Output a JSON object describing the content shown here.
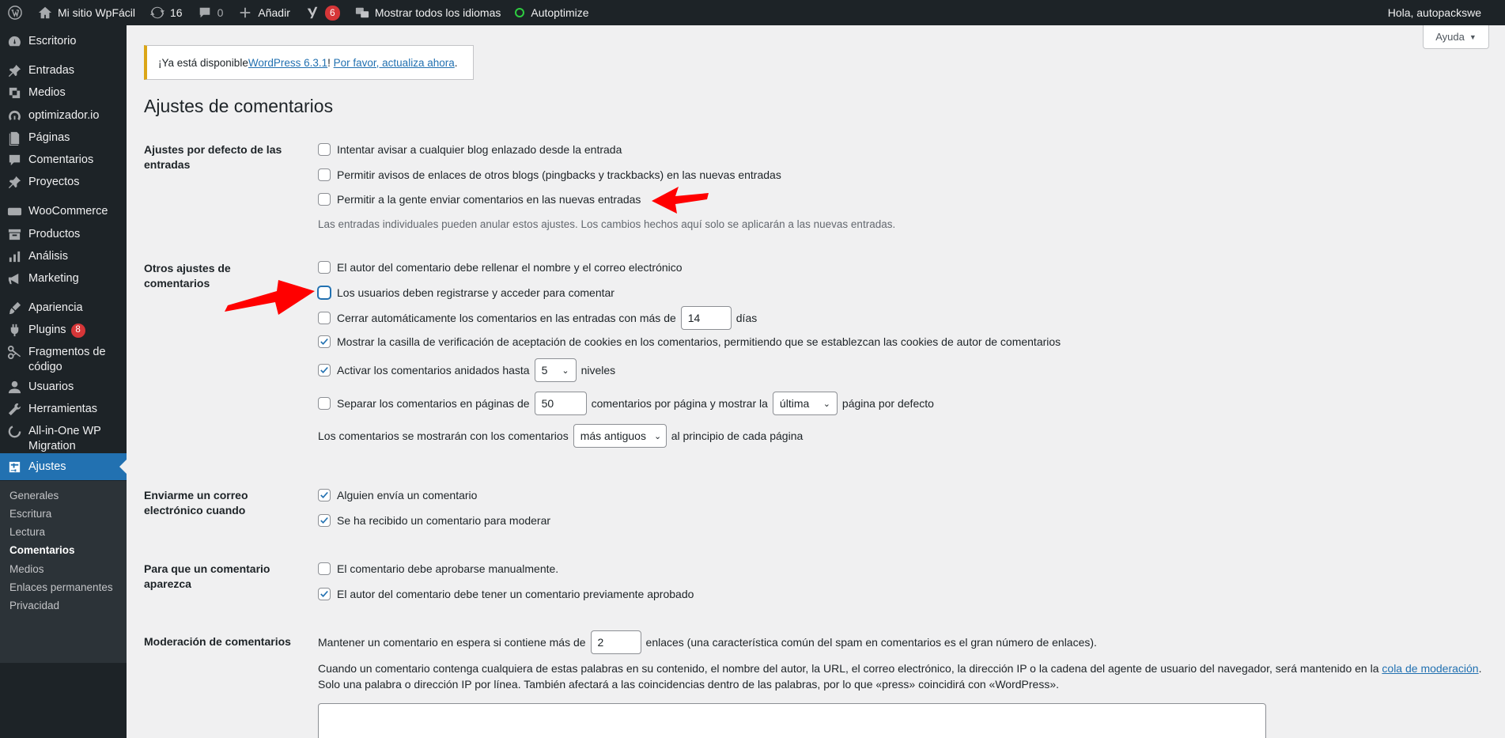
{
  "adminbar": {
    "site_name": "Mi sitio WpFácil",
    "updates_count": "16",
    "comments_count": "0",
    "add_new": "Añadir",
    "yoast_count": "6",
    "languages": "Mostrar todos los idiomas",
    "autoptimize": "Autoptimize",
    "greeting": "Hola, autopackswe"
  },
  "sidebar": {
    "items": [
      {
        "label": "Escritorio",
        "icon": "dashboard-icon"
      },
      {
        "label": "Entradas",
        "icon": "pin-icon"
      },
      {
        "label": "Medios",
        "icon": "media-icon"
      },
      {
        "label": "optimizador.io",
        "icon": "gauge-icon"
      },
      {
        "label": "Páginas",
        "icon": "page-icon"
      },
      {
        "label": "Comentarios",
        "icon": "comment-icon"
      },
      {
        "label": "Proyectos",
        "icon": "pin-icon"
      },
      {
        "label": "WooCommerce",
        "icon": "woo-icon"
      },
      {
        "label": "Productos",
        "icon": "archive-icon"
      },
      {
        "label": "Análisis",
        "icon": "chart-icon"
      },
      {
        "label": "Marketing",
        "icon": "megaphone-icon"
      },
      {
        "label": "Apariencia",
        "icon": "brush-icon"
      },
      {
        "label": "Plugins",
        "icon": "plugin-icon",
        "badge": "8"
      },
      {
        "label": "Fragmentos de código",
        "icon": "scissors-icon"
      },
      {
        "label": "Usuarios",
        "icon": "user-icon"
      },
      {
        "label": "Herramientas",
        "icon": "wrench-icon"
      },
      {
        "label": "All-in-One WP Migration",
        "icon": "migration-icon"
      },
      {
        "label": "Ajustes",
        "icon": "settings-icon"
      }
    ],
    "submenu": [
      "Generales",
      "Escritura",
      "Lectura",
      "Comentarios",
      "Medios",
      "Enlaces permanentes",
      "Privacidad"
    ]
  },
  "help_tab": "Ayuda",
  "notice": {
    "prefix": "¡Ya está disponible ",
    "version_link": "WordPress 6.3.1",
    "middle": "! ",
    "update_link": "Por favor, actualiza ahora",
    "suffix": "."
  },
  "page_title": "Ajustes de comentarios",
  "sections": {
    "defaults": {
      "label": "Ajustes por defecto de las entradas",
      "opt1": "Intentar avisar a cualquier blog enlazado desde la entrada",
      "opt2": "Permitir avisos de enlaces de otros blogs (pingbacks y trackbacks) en las nuevas entradas",
      "opt3": "Permitir a la gente enviar comentarios en las nuevas entradas",
      "note": "Las entradas individuales pueden anular estos ajustes. Los cambios hechos aquí solo se aplicarán a las nuevas entradas."
    },
    "other": {
      "label": "Otros ajustes de comentarios",
      "opt1": "El autor del comentario debe rellenar el nombre y el correo electrónico",
      "opt2": "Los usuarios deben registrarse y acceder para comentar",
      "opt3_before": "Cerrar automáticamente los comentarios en las entradas con más de",
      "opt3_value": "14",
      "opt3_after": "días",
      "opt4": "Mostrar la casilla de verificación de aceptación de cookies en los comentarios, permitiendo que se establezcan las cookies de autor de comentarios",
      "opt5_before": "Activar los comentarios anidados hasta",
      "opt5_value": "5",
      "opt5_after": "niveles",
      "opt6_before": "Separar los comentarios en páginas de",
      "opt6_value": "50",
      "opt6_middle": "comentarios por página y mostrar la",
      "opt6_select": "última",
      "opt6_after": "página por defecto",
      "order_before": "Los comentarios se mostrarán con los comentarios",
      "order_select": "más antiguos",
      "order_after": "al principio de cada página"
    },
    "email": {
      "label": "Enviarme un correo electrónico cuando",
      "opt1": "Alguien envía un comentario",
      "opt2": "Se ha recibido un comentario para moderar"
    },
    "appear": {
      "label": "Para que un comentario aparezca",
      "opt1": "El comentario debe aprobarse manualmente.",
      "opt2": "El autor del comentario debe tener un comentario previamente aprobado"
    },
    "moderation": {
      "label": "Moderación de comentarios",
      "hold_before": "Mantener un comentario en espera si contiene más de",
      "hold_value": "2",
      "hold_after": "enlaces (una característica común del spam en comentarios es el gran número de enlaces).",
      "desc1": "Cuando un comentario contenga cualquiera de estas palabras en su contenido, el nombre del autor, la URL, el correo electrónico, la dirección IP o la cadena del agente de usuario del navegador, será mantenido en la ",
      "desc_link": "cola de moderación",
      "desc1_end": ".",
      "desc2": "Solo una palabra o dirección IP por línea. También afectará a las coincidencias dentro de las palabras, por lo que «press» coincidirá con «WordPress»."
    }
  },
  "colors": {
    "accent": "#2271b1",
    "arrow": "#ff0000",
    "notice_border": "#dba617",
    "badge": "#d63638"
  }
}
